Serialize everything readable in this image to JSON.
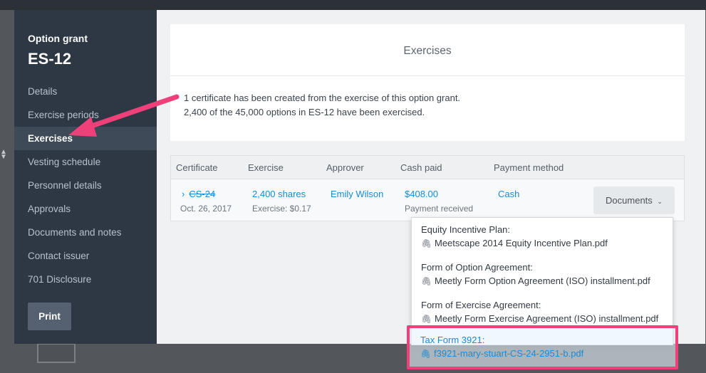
{
  "grant": {
    "kicker": "Option grant",
    "title": "ES-12"
  },
  "sidebar": {
    "items": [
      {
        "label": "Details"
      },
      {
        "label": "Exercise periods"
      },
      {
        "label": "Exercises"
      },
      {
        "label": "Vesting schedule"
      },
      {
        "label": "Personnel details"
      },
      {
        "label": "Approvals"
      },
      {
        "label": "Documents and notes"
      },
      {
        "label": "Contact issuer"
      },
      {
        "label": "701 Disclosure"
      }
    ],
    "active": "Exercises",
    "print_label": "Print"
  },
  "exercises_card": {
    "title": "Exercises",
    "line1": "1 certificate has been created from the exercise of this option grant.",
    "line2": "2,400 of the 45,000 options in ES-12 have been exercised."
  },
  "table": {
    "headers": [
      "Certificate",
      "Exercise",
      "Approver",
      "Cash paid",
      "Payment method"
    ],
    "row": {
      "certificate": "CS-24",
      "certificate_date": "Oct. 26, 2017",
      "exercise": "2,400 shares",
      "exercise_sub": "Exercise: $0.17",
      "approver": "Emily Wilson",
      "cash_paid": "$408.00",
      "cash_paid_sub": "Payment received",
      "payment_method": "Cash",
      "documents_label": "Documents"
    }
  },
  "documents_menu": {
    "groups": [
      {
        "label": "Equity Incentive Plan:",
        "file": "Meetscape 2014 Equity Incentive Plan.pdf"
      },
      {
        "label": "Form of Option Agreement:",
        "file": "Meetly Form Option Agreement (ISO) installment.pdf"
      },
      {
        "label": "Form of Exercise Agreement:",
        "file": "Meetly Form Exercise Agreement (ISO) installment.pdf"
      },
      {
        "label": "Tax Form 3921:",
        "file": "f3921-mary-stuart-CS-24-2951-b.pdf"
      }
    ]
  },
  "colors": {
    "accent": "#1a8ad4",
    "annotation": "#f0407a",
    "sidebar": "#2e3844"
  },
  "icons": {
    "chevron": "chevron-right-icon",
    "caret": "chevron-down-icon",
    "attachment": "paperclip-icon"
  }
}
